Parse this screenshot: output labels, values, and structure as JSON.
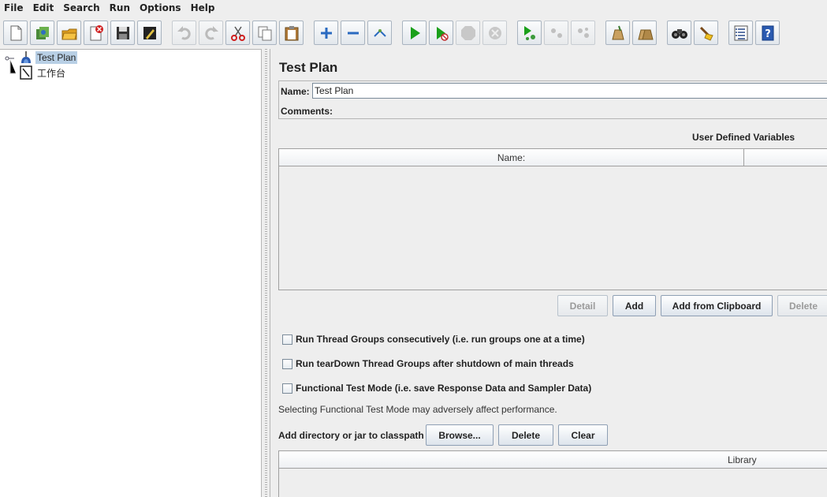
{
  "menu": [
    "File",
    "Edit",
    "Search",
    "Run",
    "Options",
    "Help"
  ],
  "toolbar": {
    "buttons": [
      {
        "icon": "new-icon"
      },
      {
        "icon": "templates-icon"
      },
      {
        "icon": "open-icon"
      },
      {
        "icon": "close-icon"
      },
      {
        "icon": "save-icon"
      },
      {
        "icon": "save-as-icon"
      },
      {
        "icon": "undo-icon"
      },
      {
        "icon": "redo-icon"
      },
      {
        "icon": "cut-icon"
      },
      {
        "icon": "copy-icon"
      },
      {
        "icon": "paste-icon"
      },
      {
        "icon": "expand-icon"
      },
      {
        "icon": "collapse-icon"
      },
      {
        "icon": "toggle-icon"
      },
      {
        "icon": "start-icon"
      },
      {
        "icon": "start-no-pauses-icon"
      },
      {
        "icon": "stop-icon"
      },
      {
        "icon": "shutdown-icon"
      },
      {
        "icon": "remote-start-icon"
      },
      {
        "icon": "remote-stop-icon"
      },
      {
        "icon": "remote-shutdown-icon"
      },
      {
        "icon": "clear-icon"
      },
      {
        "icon": "clear-all-icon"
      },
      {
        "icon": "search-icon"
      },
      {
        "icon": "reset-search-icon"
      },
      {
        "icon": "function-helper-icon"
      },
      {
        "icon": "help-icon"
      }
    ]
  },
  "tree": {
    "items": [
      {
        "label": "Test Plan",
        "icon": "test-plan-icon",
        "selected": true
      },
      {
        "label": "工作台",
        "icon": "workbench-icon",
        "selected": false
      }
    ]
  },
  "panel": {
    "title": "Test Plan",
    "name_label": "Name:",
    "name_value": "Test Plan",
    "comments_label": "Comments:",
    "comments_value": "",
    "udv_title": "User Defined Variables",
    "udv_columns": [
      "Name:",
      ""
    ],
    "buttons": {
      "detail": "Detail",
      "add": "Add",
      "add_clipboard": "Add from Clipboard",
      "delete": "Delete"
    },
    "checkboxes": [
      {
        "label": "Run Thread Groups consecutively (i.e. run groups one at a time)",
        "checked": false
      },
      {
        "label": "Run tearDown Thread Groups after shutdown of main threads",
        "checked": false
      },
      {
        "label": "Functional Test Mode (i.e. save Response Data and Sampler Data)",
        "checked": false
      }
    ],
    "info": "Selecting Functional Test Mode may adversely affect performance.",
    "classpath_label": "Add directory or jar to classpath",
    "classpath_buttons": {
      "browse": "Browse...",
      "delete": "Delete",
      "clear": "Clear"
    },
    "library_column": "Library"
  }
}
